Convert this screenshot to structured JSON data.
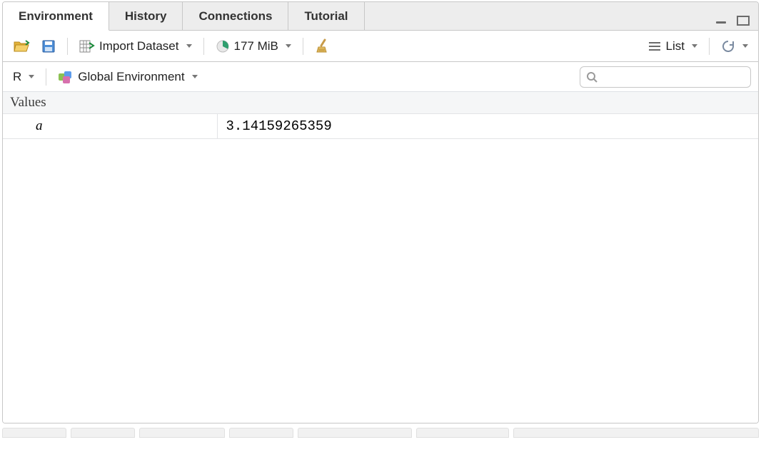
{
  "tabs": [
    {
      "label": "Environment",
      "active": true
    },
    {
      "label": "History",
      "active": false
    },
    {
      "label": "Connections",
      "active": false
    },
    {
      "label": "Tutorial",
      "active": false
    }
  ],
  "toolbar": {
    "import_dataset": "Import Dataset",
    "memory": "177 MiB",
    "view_mode": "List"
  },
  "scope": {
    "language": "R",
    "environment": "Global Environment"
  },
  "search": {
    "placeholder": ""
  },
  "section_header": "Values",
  "variables": [
    {
      "name": "a",
      "value": "3.14159265359"
    }
  ]
}
